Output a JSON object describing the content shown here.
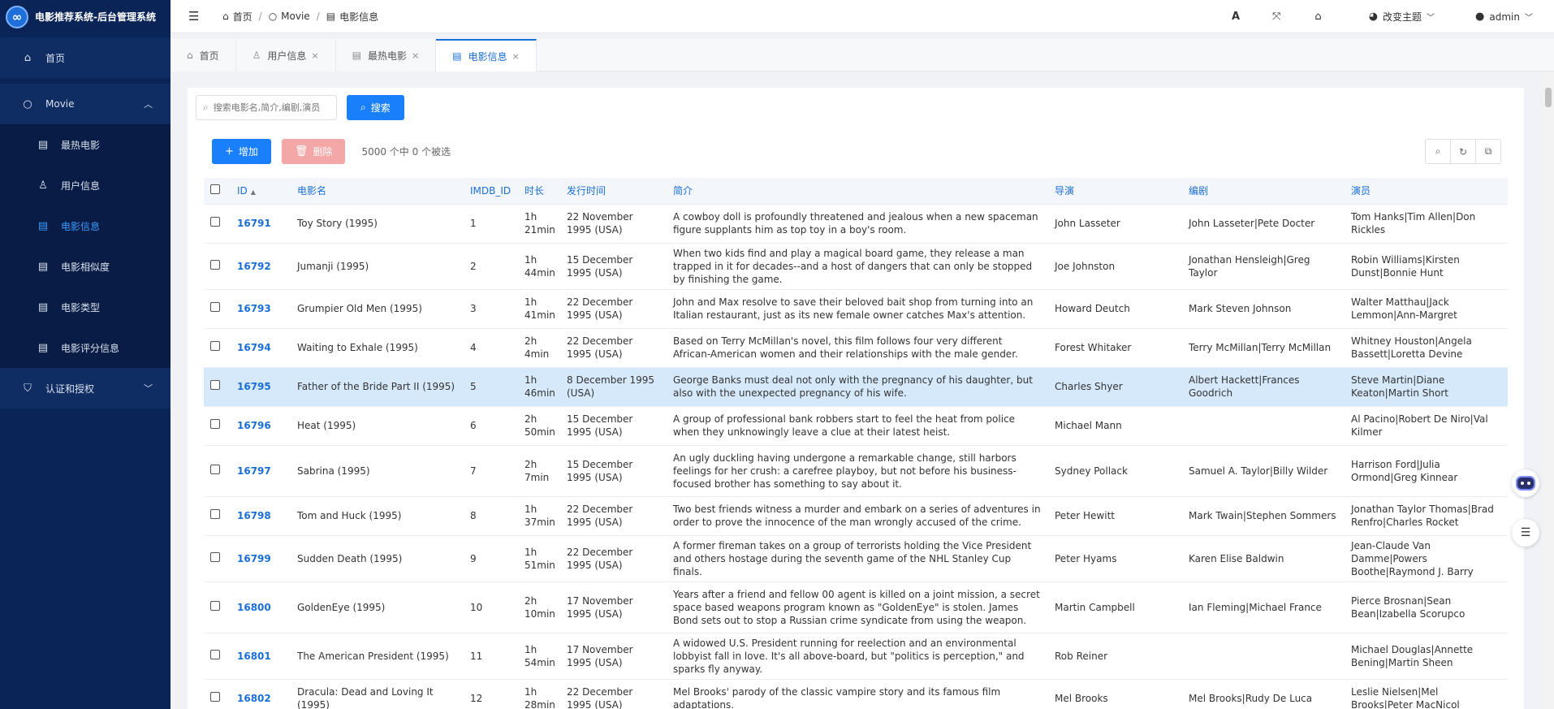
{
  "brand": {
    "title": "电影推荐系统-后台管理系统",
    "logo_glyph": "∞"
  },
  "sidebar": {
    "home": "首页",
    "movie_group": "Movie",
    "items": [
      {
        "label": "最热电影",
        "icon": "film-icon"
      },
      {
        "label": "用户信息",
        "icon": "user-icon"
      },
      {
        "label": "电影信息",
        "icon": "film-icon",
        "active": true
      },
      {
        "label": "电影相似度",
        "icon": "film-icon"
      },
      {
        "label": "电影类型",
        "icon": "film-icon"
      },
      {
        "label": "电影评分信息",
        "icon": "film-icon"
      }
    ],
    "auth_group": "认证和授权"
  },
  "header": {
    "breadcrumb": [
      "首页",
      "Movie",
      "电影信息"
    ],
    "theme_label": "改变主题",
    "user": "admin"
  },
  "tabs": [
    {
      "label": "首页",
      "icon": "home-icon",
      "closable": false
    },
    {
      "label": "用户信息",
      "icon": "user-icon",
      "closable": true
    },
    {
      "label": "最热电影",
      "icon": "film-icon",
      "closable": true
    },
    {
      "label": "电影信息",
      "icon": "film-icon",
      "closable": true,
      "active": true
    }
  ],
  "search": {
    "placeholder": "搜索电影名,简介,编剧,演员",
    "button": "搜索"
  },
  "toolbar": {
    "add": "增加",
    "delete": "删除",
    "selection": "5000 个中 0 个被选"
  },
  "table": {
    "columns": [
      "ID",
      "电影名",
      "IMDB_ID",
      "时长",
      "发行时间",
      "简介",
      "导演",
      "编剧",
      "演员"
    ],
    "rows": [
      {
        "id": "16791",
        "name": "Toy Story (1995)",
        "imdb": "1",
        "duration": "1h 21min",
        "release": "22 November 1995 (USA)",
        "intro": "A cowboy doll is profoundly threatened and jealous when a new spaceman figure supplants him as top toy in a boy's room.",
        "director": "John Lasseter",
        "writer": "John Lasseter|Pete Docter",
        "actors": "Tom Hanks|Tim Allen|Don Rickles"
      },
      {
        "id": "16792",
        "name": "Jumanji (1995)",
        "imdb": "2",
        "duration": "1h 44min",
        "release": "15 December 1995 (USA)",
        "intro": "When two kids find and play a magical board game, they release a man trapped in it for decades--and a host of dangers that can only be stopped by finishing the game.",
        "director": "Joe Johnston",
        "writer": "Jonathan Hensleigh|Greg Taylor",
        "actors": "Robin Williams|Kirsten Dunst|Bonnie Hunt"
      },
      {
        "id": "16793",
        "name": "Grumpier Old Men (1995)",
        "imdb": "3",
        "duration": "1h 41min",
        "release": "22 December 1995 (USA)",
        "intro": "John and Max resolve to save their beloved bait shop from turning into an Italian restaurant, just as its new female owner catches Max's attention.",
        "director": "Howard Deutch",
        "writer": "Mark Steven Johnson",
        "actors": "Walter Matthau|Jack Lemmon|Ann-Margret"
      },
      {
        "id": "16794",
        "name": "Waiting to Exhale (1995)",
        "imdb": "4",
        "duration": "2h 4min",
        "release": "22 December 1995 (USA)",
        "intro": "Based on Terry McMillan's novel, this film follows four very different African-American women and their relationships with the male gender.",
        "director": "Forest Whitaker",
        "writer": "Terry McMillan|Terry McMillan",
        "actors": "Whitney Houston|Angela Bassett|Loretta Devine"
      },
      {
        "id": "16795",
        "name": "Father of the Bride Part II (1995)",
        "imdb": "5",
        "duration": "1h 46min",
        "release": "8 December 1995 (USA)",
        "intro": "George Banks must deal not only with the pregnancy of his daughter, but also with the unexpected pregnancy of his wife.",
        "director": "Charles Shyer",
        "writer": "Albert Hackett|Frances Goodrich",
        "actors": "Steve Martin|Diane Keaton|Martin Short",
        "selected": true
      },
      {
        "id": "16796",
        "name": "Heat (1995)",
        "imdb": "6",
        "duration": "2h 50min",
        "release": "15 December 1995 (USA)",
        "intro": "A group of professional bank robbers start to feel the heat from police when they unknowingly leave a clue at their latest heist.",
        "director": "Michael Mann",
        "writer": "",
        "actors": "Al Pacino|Robert De Niro|Val Kilmer"
      },
      {
        "id": "16797",
        "name": "Sabrina (1995)",
        "imdb": "7",
        "duration": "2h 7min",
        "release": "15 December 1995 (USA)",
        "intro": "An ugly duckling having undergone a remarkable change, still harbors feelings for her crush: a carefree playboy, but not before his business-focused brother has something to say about it.",
        "director": "Sydney Pollack",
        "writer": "Samuel A. Taylor|Billy Wilder",
        "actors": "Harrison Ford|Julia Ormond|Greg Kinnear",
        "tall": true
      },
      {
        "id": "16798",
        "name": "Tom and Huck (1995)",
        "imdb": "8",
        "duration": "1h 37min",
        "release": "22 December 1995 (USA)",
        "intro": "Two best friends witness a murder and embark on a series of adventures in order to prove the innocence of the man wrongly accused of the crime.",
        "director": "Peter Hewitt",
        "writer": "Mark Twain|Stephen Sommers",
        "actors": "Jonathan Taylor Thomas|Brad Renfro|Charles Rocket"
      },
      {
        "id": "16799",
        "name": "Sudden Death (1995)",
        "imdb": "9",
        "duration": "1h 51min",
        "release": "22 December 1995 (USA)",
        "intro": "A former fireman takes on a group of terrorists holding the Vice President and others hostage during the seventh game of the NHL Stanley Cup finals.",
        "director": "Peter Hyams",
        "writer": "Karen Elise Baldwin",
        "actors": "Jean-Claude Van Damme|Powers Boothe|Raymond J. Barry"
      },
      {
        "id": "16800",
        "name": "GoldenEye (1995)",
        "imdb": "10",
        "duration": "2h 10min",
        "release": "17 November 1995 (USA)",
        "intro": "Years after a friend and fellow 00 agent is killed on a joint mission, a secret space based weapons program known as \"GoldenEye\" is stolen. James Bond sets out to stop a Russian crime syndicate from using the weapon.",
        "director": "Martin Campbell",
        "writer": "Ian Fleming|Michael France",
        "actors": "Pierce Brosnan|Sean Bean|Izabella Scorupco",
        "tall": true
      },
      {
        "id": "16801",
        "name": "The American President (1995)",
        "imdb": "11",
        "duration": "1h 54min",
        "release": "17 November 1995 (USA)",
        "intro": "A widowed U.S. President running for reelection and an environmental lobbyist fall in love. It's all above-board, but \"politics is perception,\" and sparks fly anyway.",
        "director": "Rob Reiner",
        "writer": "",
        "actors": "Michael Douglas|Annette Bening|Martin Sheen"
      },
      {
        "id": "16802",
        "name": "Dracula: Dead and Loving It (1995)",
        "imdb": "12",
        "duration": "1h 28min",
        "release": "22 December 1995 (USA)",
        "intro": "Mel Brooks' parody of the classic vampire story and its famous film adaptations.",
        "director": "Mel Brooks",
        "writer": "Mel Brooks|Rudy De Luca",
        "actors": "Leslie Nielsen|Mel Brooks|Peter MacNicol"
      }
    ]
  },
  "colors": {
    "sidebar_bg": "#0b2457",
    "accent": "#1a7ffa",
    "delete": "#f4a7a7",
    "selected_row": "#d6e9fb"
  }
}
